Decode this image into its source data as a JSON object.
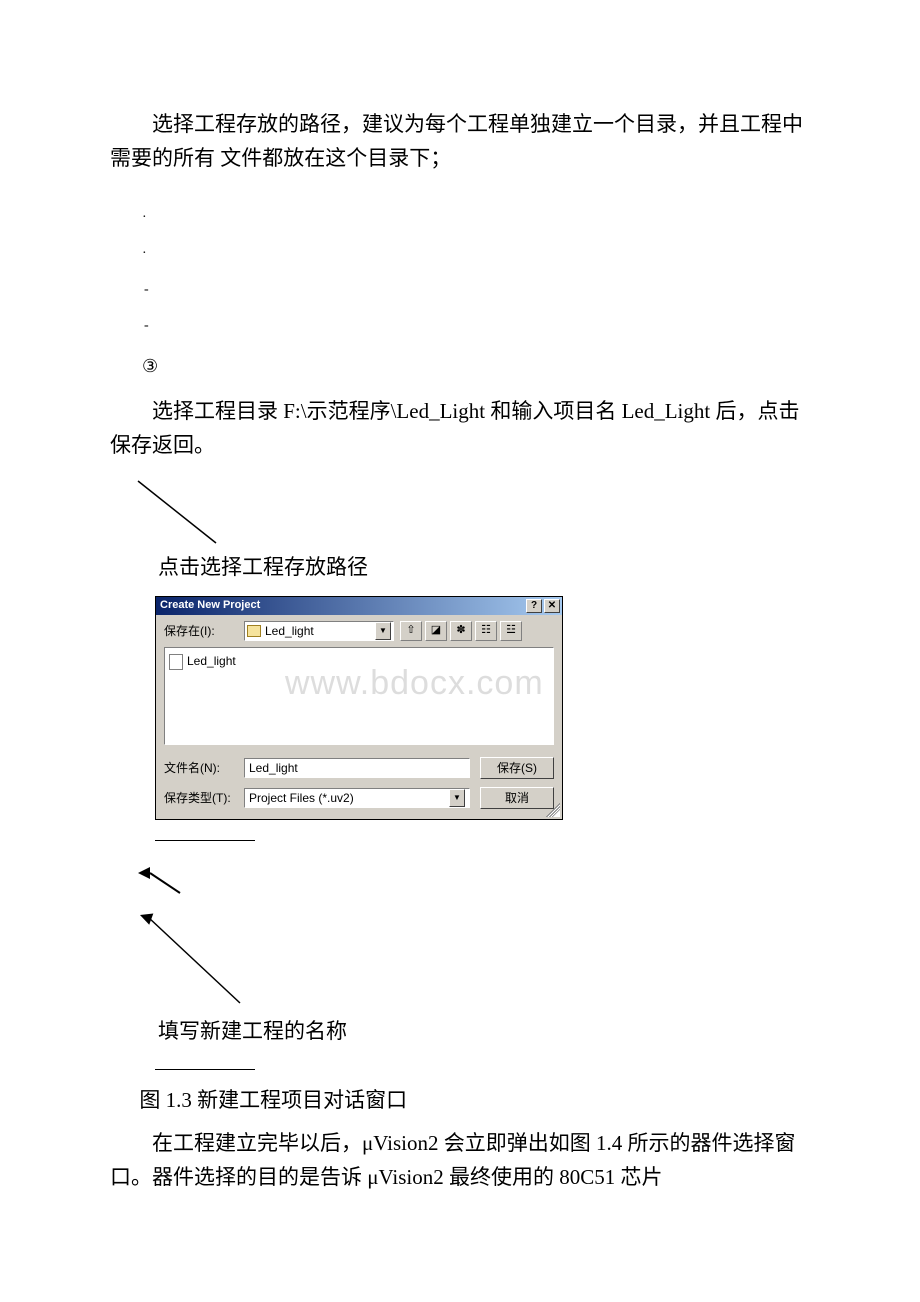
{
  "para1": "选择工程存放的路径，建议为每个工程单独建立一个目录，并且工程中需要的所有 文件都放在这个目录下；",
  "circled3": "③",
  "para2_a": "选择工程目录 F:\\示范程序\\Led_Light 和输入项目名 Led_Light 后，点击保存返回。",
  "cap1": "点击选择工程存放路径",
  "dialog": {
    "title": "Create New Project",
    "help_glyph": "?",
    "close_glyph": "✕",
    "save_in_label": "保存在(I):",
    "folder_name": "Led_light",
    "dd_glyph": "▼",
    "icons": {
      "up": "⇧",
      "desktop": "◪",
      "newfolder": "✽",
      "list": "☷",
      "details": "☳"
    },
    "file_item": "Led_light",
    "watermark": "www.bdocx.com",
    "filename_label": "文件名(N):",
    "filename_value": "Led_light",
    "filetype_label": "保存类型(T):",
    "filetype_value": "Project Files (*.uv2)",
    "save_btn": "保存(S)",
    "cancel_btn": "取消"
  },
  "cap2": "填写新建工程的名称",
  "fig_cap": "图 1.3 新建工程项目对话窗口",
  "para3": "在工程建立完毕以后，μVision2 会立即弹出如图 1.4 所示的器件选择窗口。器件选择的目的是告诉 μVision2 最终使用的 80C51 芯片"
}
